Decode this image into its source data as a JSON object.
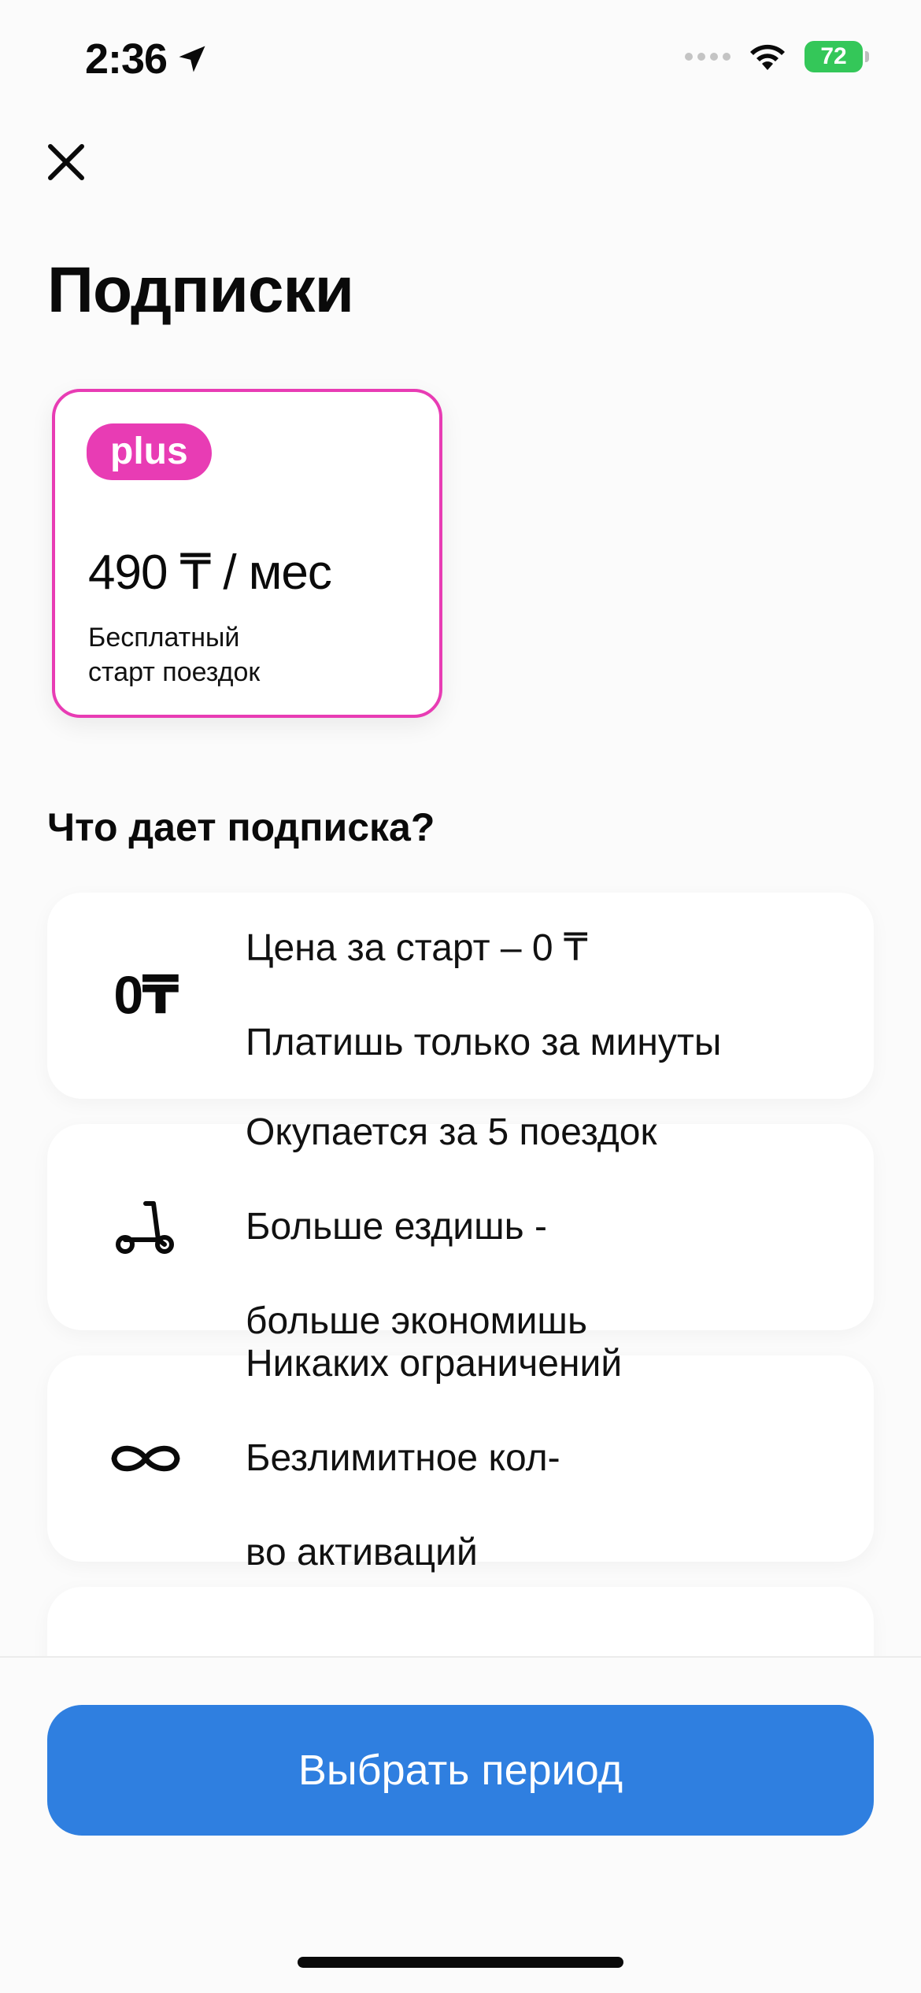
{
  "status_bar": {
    "time": "2:36",
    "battery": "72"
  },
  "header": {
    "title": "Подписки"
  },
  "plan": {
    "badge": "plus",
    "price": "490 ₸ / мес",
    "description_lines": [
      "Бесплатный",
      "старт поездок"
    ]
  },
  "section": {
    "title": "Что дает подписка?"
  },
  "benefits": [
    {
      "icon": "zero-tenge-icon",
      "icon_text": "0₸",
      "lines": [
        "Цена за старт – 0 ₸",
        "Платишь только за минуты"
      ]
    },
    {
      "icon": "scooter-icon",
      "lines": [
        "Окупается за 5 поездок",
        "Больше ездишь -",
        "больше экономишь"
      ]
    },
    {
      "icon": "infinity-icon",
      "lines": [
        "Никаких ограничений",
        "Безлимитное кол-",
        "во активаций"
      ]
    },
    {
      "icon": "unknown-icon",
      "lines": []
    }
  ],
  "footer": {
    "cta_label": "Выбрать период"
  },
  "colors": {
    "accent_pink": "#e83cb4",
    "primary_blue": "#2f7fe0",
    "battery_green": "#34c759"
  }
}
